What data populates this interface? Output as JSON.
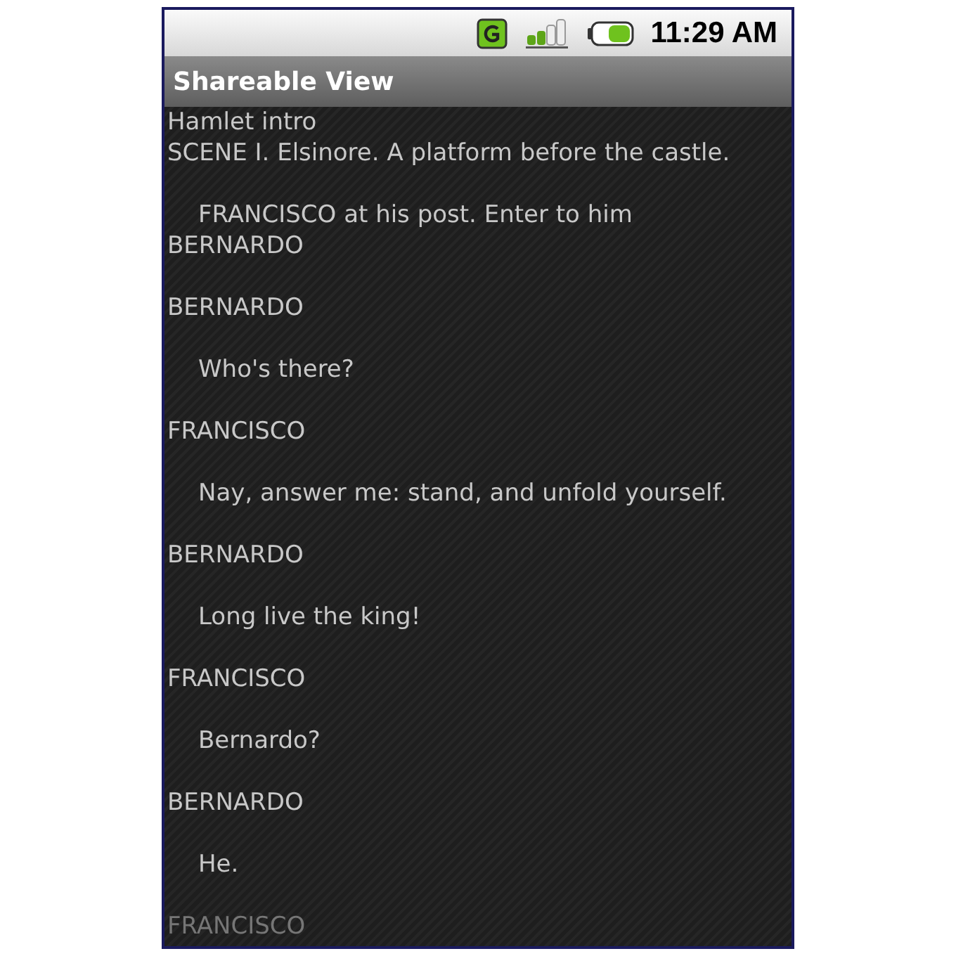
{
  "status_bar": {
    "time": "11:29 AM"
  },
  "title_bar": {
    "title": "Shareable View"
  },
  "lines": [
    {
      "kind": "title",
      "text": "Hamlet intro"
    },
    {
      "kind": "scene",
      "text": "SCENE I. Elsinore. A platform before the castle."
    },
    {
      "kind": "stage",
      "text": "FRANCISCO at his post. Enter to him"
    },
    {
      "kind": "entrance",
      "text": "BERNARDO"
    },
    {
      "kind": "speaker",
      "text": "BERNARDO"
    },
    {
      "kind": "speech",
      "text": "Who's there?"
    },
    {
      "kind": "speaker",
      "text": "FRANCISCO"
    },
    {
      "kind": "speech",
      "text": "Nay, answer me: stand, and unfold yourself."
    },
    {
      "kind": "speaker",
      "text": "BERNARDO"
    },
    {
      "kind": "speech",
      "text": "Long live the king!"
    },
    {
      "kind": "speaker",
      "text": "FRANCISCO"
    },
    {
      "kind": "speech",
      "text": "Bernardo?"
    },
    {
      "kind": "speaker",
      "text": "BERNARDO"
    },
    {
      "kind": "speech",
      "text": "He."
    },
    {
      "kind": "speaker",
      "text": "FRANCISCO",
      "faded": true
    }
  ]
}
